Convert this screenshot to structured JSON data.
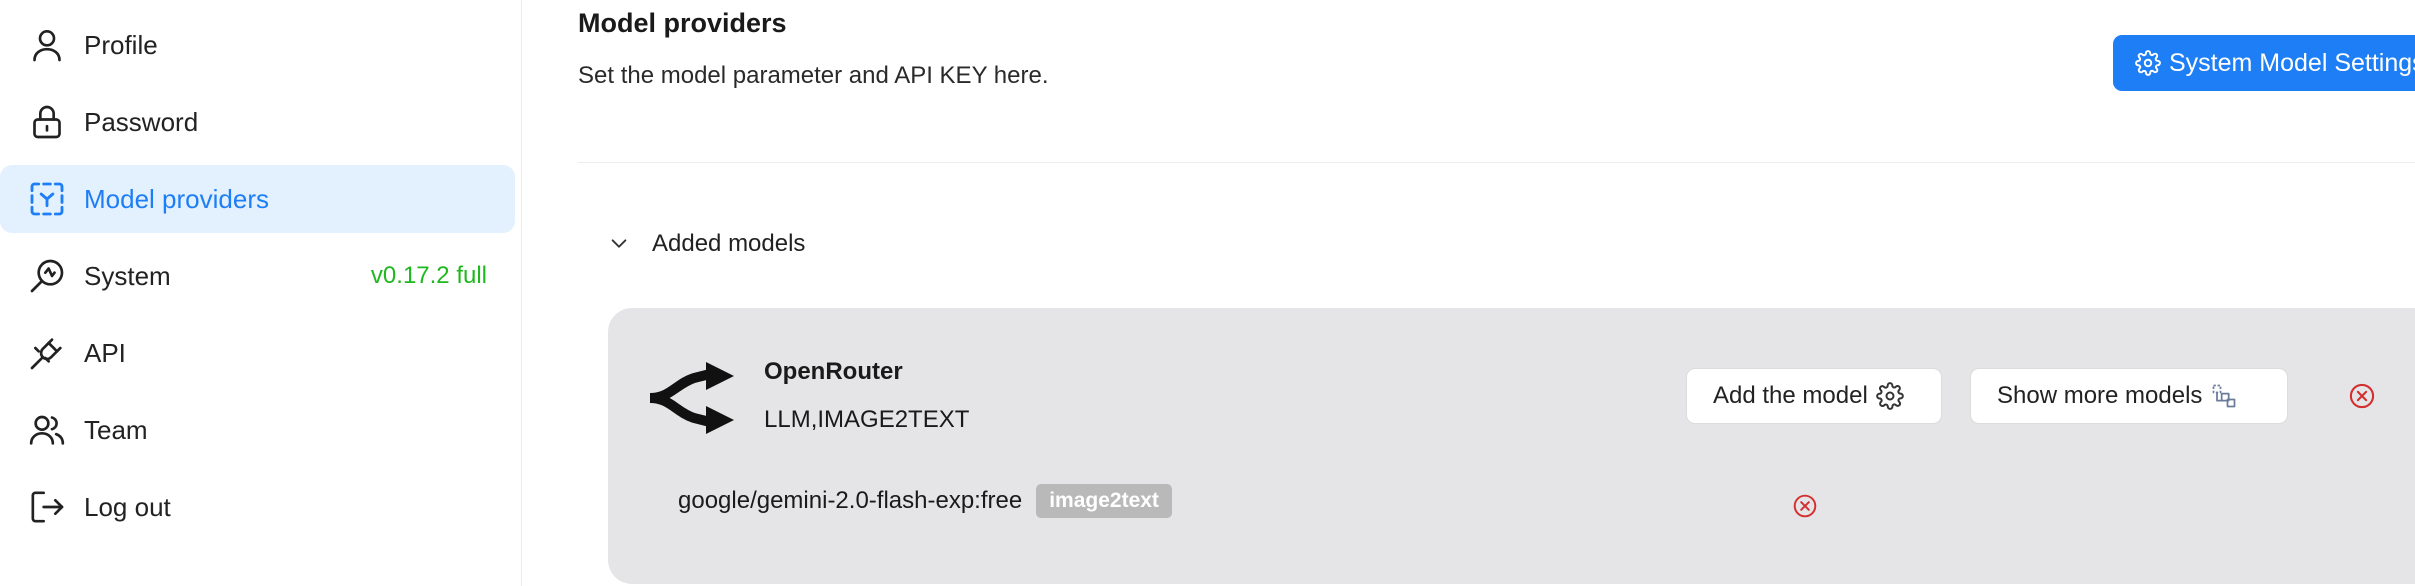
{
  "sidebar": {
    "items": [
      {
        "label": "Profile",
        "icon": "user-icon"
      },
      {
        "label": "Password",
        "icon": "lock-icon"
      },
      {
        "label": "Model providers",
        "icon": "model-providers-icon",
        "active": true
      },
      {
        "label": "System",
        "icon": "system-icon",
        "version": "v0.17.2 full"
      },
      {
        "label": "API",
        "icon": "plug-icon"
      },
      {
        "label": "Team",
        "icon": "team-icon"
      },
      {
        "label": "Log out",
        "icon": "logout-icon"
      }
    ]
  },
  "main": {
    "title": "Model providers",
    "description": "Set the model parameter and API KEY here.",
    "system_button_label": "System Model Settings",
    "section_label": "Added models",
    "provider": {
      "name": "OpenRouter",
      "tags": "LLM,IMAGE2TEXT",
      "add_model_label": "Add the model",
      "show_more_label": "Show more models",
      "models": [
        {
          "name": "google/gemini-2.0-flash-exp:free",
          "tag": "image2text"
        }
      ]
    }
  },
  "colors": {
    "accent": "#1e7ef5",
    "active_bg": "#e3f0fd",
    "version": "#1fb81f",
    "card_bg": "#e5e5e7",
    "delete": "#d32f2f",
    "tag_bg": "#b9b9b9"
  }
}
